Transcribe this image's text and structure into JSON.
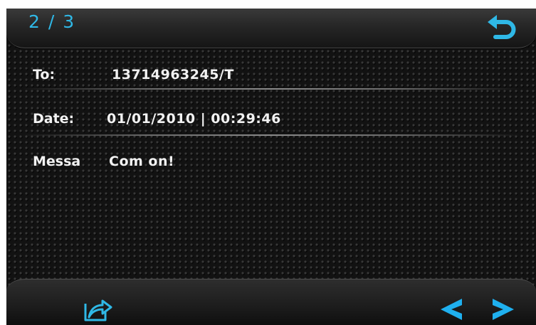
{
  "header": {
    "page_indicator": "2 / 3",
    "back_icon": "undo-arrow-icon"
  },
  "message": {
    "to_label": "To:",
    "to_value": "13714963245/T",
    "date_label": "Date:",
    "date_value": "01/01/2010 | 00:29:46",
    "message_label": "Messa",
    "message_value": "Com on!"
  },
  "footer": {
    "forward_icon": "forward-share-icon",
    "prev_icon": "chevron-left-icon",
    "next_icon": "chevron-right-icon"
  },
  "colors": {
    "accent": "#2fb8e6",
    "text": "#f2f2f2",
    "background": "#121212"
  }
}
